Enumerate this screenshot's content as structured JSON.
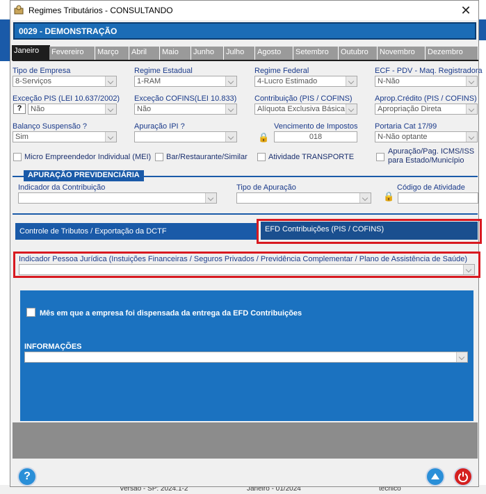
{
  "window": {
    "title": "Regimes Tributários  -  CONSULTANDO",
    "company": "0029 - DEMONSTRAÇÃO"
  },
  "months": [
    "Janeiro",
    "Fevereiro",
    "Março",
    "Abril",
    "Maio",
    "Junho",
    "Julho",
    "Agosto",
    "Setembro",
    "Outubro",
    "Novembro",
    "Dezembro"
  ],
  "fields": {
    "tipo_empresa": {
      "label": "Tipo de Empresa",
      "value": "8-Serviços"
    },
    "regime_estadual": {
      "label": "Regime Estadual",
      "value": "1-RAM"
    },
    "regime_federal": {
      "label": "Regime Federal",
      "value": "4-Lucro Estimado"
    },
    "ecf": {
      "label": "ECF - PDV - Maq. Registradora",
      "value": "N-Não"
    },
    "excecao_pis": {
      "label": "Exceção PIS (LEI 10.637/2002)",
      "value": "Não",
      "help": "?"
    },
    "excecao_cofins": {
      "label": "Exceção COFINS(LEI 10.833)",
      "value": "Não"
    },
    "contribuicao": {
      "label": "Contribuição (PIS / COFINS)",
      "value": "Alíquota Exclusiva Básica"
    },
    "aprop_credito": {
      "label": "Aprop.Crédito (PIS / COFINS)",
      "value": "Apropriação Direta"
    },
    "balanco": {
      "label": "Balanço Suspensão ?",
      "value": "Sim"
    },
    "apuracao_ipi": {
      "label": "Apuração IPI ?",
      "value": ""
    },
    "vencimento": {
      "label": "Vencimento de Impostos",
      "value": "018"
    },
    "portaria": {
      "label": "Portaria Cat 17/99",
      "value": "N-Não optante"
    }
  },
  "checks": {
    "mei": "Micro Empreendedor Individual (MEI)",
    "bar": "Bar/Restaurante/Similar",
    "transporte": "Atividade TRANSPORTE",
    "icms_line1": "Apuração/Pag. ICMS/ISS",
    "icms_line2": "para Estado/Município"
  },
  "previdenciaria": {
    "title": "APURAÇÃO PREVIDENCIÁRIA",
    "indicador": "Indicador da Contribuição",
    "tipo": "Tipo de Apuração",
    "codigo": "Código de Atividade"
  },
  "subtabs": {
    "dctf": "Controle de Tributos / Exportação da DCTF",
    "efd": "EFD Contribuições (PIS / COFINS)"
  },
  "efd": {
    "indicador_pj": "Indicador Pessoa Jurídica (Instuições Financeiras / Seguros Privados / Previdência Complementar / Plano de Assistência de Saúde)",
    "dispensada": "Mês em que a empresa foi dispensada da entrega da EFD Contribuições",
    "informacoes": "INFORMAÇÕES"
  },
  "buttons": {
    "help": "?",
    "close": "✕"
  },
  "background": {
    "bottom_texts": [
      "Versão - SP: 2024.1-2",
      "Janeiro - 01/2024",
      "técnico"
    ]
  }
}
